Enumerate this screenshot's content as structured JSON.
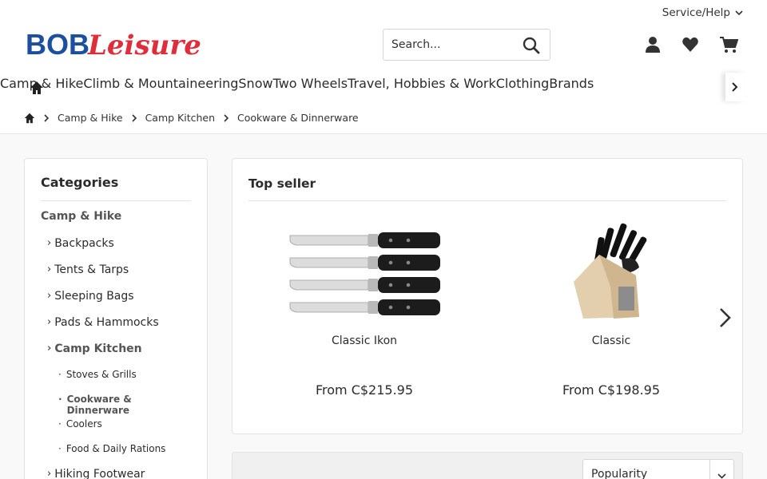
{
  "header": {
    "service_label": "Service/Help",
    "logo": {
      "left": "BOB",
      "right": "Leisure",
      "blue": "#1c4fa0",
      "red": "#e02d3c"
    },
    "search_placeholder": "Search...",
    "actions": [
      "account-icon",
      "wishlist-icon",
      "cart-icon"
    ]
  },
  "nav": {
    "items": [
      "Camp & Hike",
      "Climb & Mountaineering",
      "Snow",
      "Two Wheels",
      "Travel, Hobbies & Work",
      "Clothing",
      "Brands"
    ],
    "active_color": "#1f6ea7"
  },
  "breadcrumb": [
    "Camp & Hike",
    "Camp Kitchen",
    "Cookware & Dinnerware"
  ],
  "sidebar": {
    "title": "Categories",
    "root": "Camp & Hike",
    "items": [
      {
        "label": "Backpacks",
        "level": 1
      },
      {
        "label": "Tents & Tarps",
        "level": 1
      },
      {
        "label": "Sleeping Bags",
        "level": 1
      },
      {
        "label": "Pads & Hammocks",
        "level": 1
      },
      {
        "label": "Camp Kitchen",
        "level": 1,
        "active": true
      },
      {
        "label": "Stoves & Grills",
        "level": 2
      },
      {
        "label": "Cookware & Dinnerware",
        "level": 2,
        "active": true
      },
      {
        "label": "Coolers",
        "level": 2
      },
      {
        "label": "Food & Daily Rations",
        "level": 2
      },
      {
        "label": "Hiking Footwear",
        "level": 1
      }
    ]
  },
  "topseller": {
    "title": "Top seller",
    "products": [
      {
        "name": "Classic Ikon",
        "price": "From C$215.95",
        "image": "steak-knife-set"
      },
      {
        "name": "Classic",
        "price": "From C$198.95",
        "image": "knife-block-set"
      }
    ]
  },
  "sort": {
    "selected": "Popularity"
  }
}
